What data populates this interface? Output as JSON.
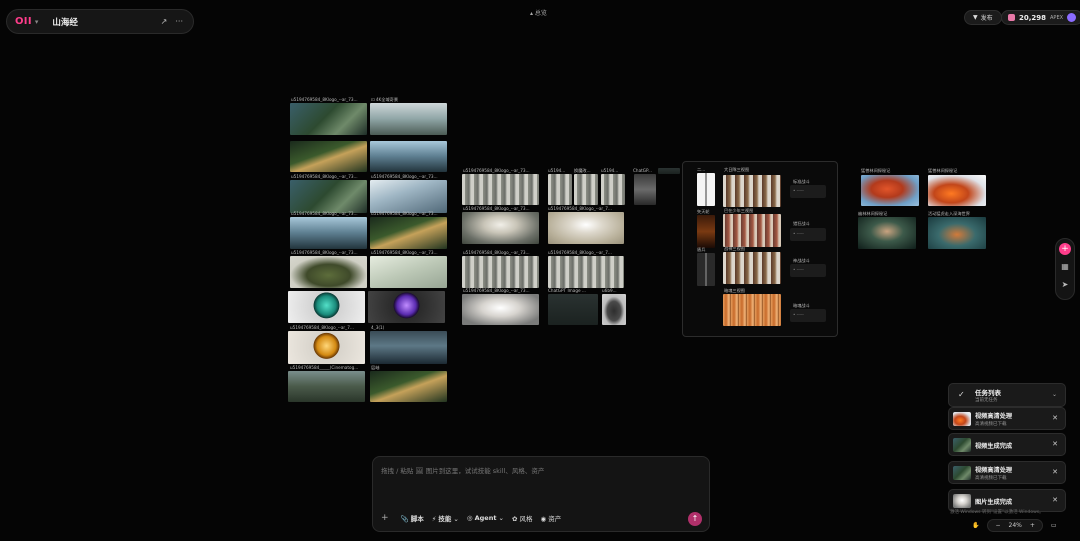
{
  "header": {
    "logo": "OII",
    "project_title": "山海经",
    "center_title": "总览",
    "publish_label": "发布",
    "credits": "20,298",
    "tier": "APEX"
  },
  "canvas": {
    "col1_caps": [
      "u5194769584_8Klogo_--ar_73...",
      "4K全域奇景"
    ],
    "caps": {
      "c1": "u5194769584_8Klogo_--ar_73...",
      "c2": "u5194769584_8Klogo_--ar_73...",
      "c3": "u5194769584_8Klogo_--ar_73...",
      "c4": "u5194769584_8Klogo_--ar_73...",
      "c5": "u5194769584_8Klogo_--ar_73...",
      "c6": "u5194769584_8Klogo_--ar_73...",
      "c7": "u5194769584_8Klogo_--ar_7...",
      "c8": "u5194769584_____(Cinematog...",
      "c9": "u5194769584_8Klogo_--ar_7...",
      "c10": "4_3(1)",
      "c11": "层岫",
      "g1": "u5194769584_8Klogo_--ar_73...",
      "g2": "u5194...",
      "g3": "换魔改...",
      "g4": "u5194...",
      "g5": "ChatGP...",
      "g6": "u5194769584_8Klogo_--ar_73...",
      "g7": "u5194769584_8Klogo_--ar_7...",
      "g8": "u5194769584_8Klogo_--ar_73...",
      "g9": "u5194769584_8Klogo_--ar_7...",
      "g10": "ChatGPT Image ...",
      "g11": "u6b9...",
      "g12": "u5194769584_8Klogo_--ar_73..."
    },
    "panel": {
      "p1": "二...",
      "p2": "大日隊三视图",
      "p3": "标准战斗",
      "p4": "矢天轮",
      "p5": "巴在少年三视图",
      "p6": "猎狂战斗",
      "p7": "盾兵",
      "p8": "战神三视图",
      "p9": "神战战斗",
      "p10": "暗魂三视图",
      "p11": "暗魂战斗",
      "slot_text": "• -----"
    },
    "right": {
      "r1": "猛兽林间探秘记",
      "r2": "猛兽林间探秘记",
      "r3": "幽林林间探秘记",
      "r4": "活动猛虎走入深海世界"
    }
  },
  "prompt": {
    "placeholder": "拖拽 / 粘贴 🖼 图片到这里，试试技能 skill、风格、资产",
    "add": "+",
    "script": "脚本",
    "skill": "技能",
    "agent": "Agent",
    "style": "风格",
    "asset": "资产"
  },
  "tasks": {
    "title": "任务列表",
    "subtitle": "当前无任务",
    "items": [
      {
        "title": "视频高清处理",
        "sub": "高清视频已下载"
      },
      {
        "title": "视频生成完成",
        "sub": ""
      },
      {
        "title": "视频高清处理",
        "sub": "高清视频已下载"
      },
      {
        "title": "图片生成完成",
        "sub": ""
      }
    ],
    "watermark": "激活 Windows 转到\"设置\"以激活 Windows。"
  },
  "zoom": {
    "value": "24%",
    "minus": "−",
    "plus": "+"
  },
  "colors": {
    "accent": "#ff3d8b",
    "background": "#050505",
    "panel": "#1a1a1a"
  }
}
